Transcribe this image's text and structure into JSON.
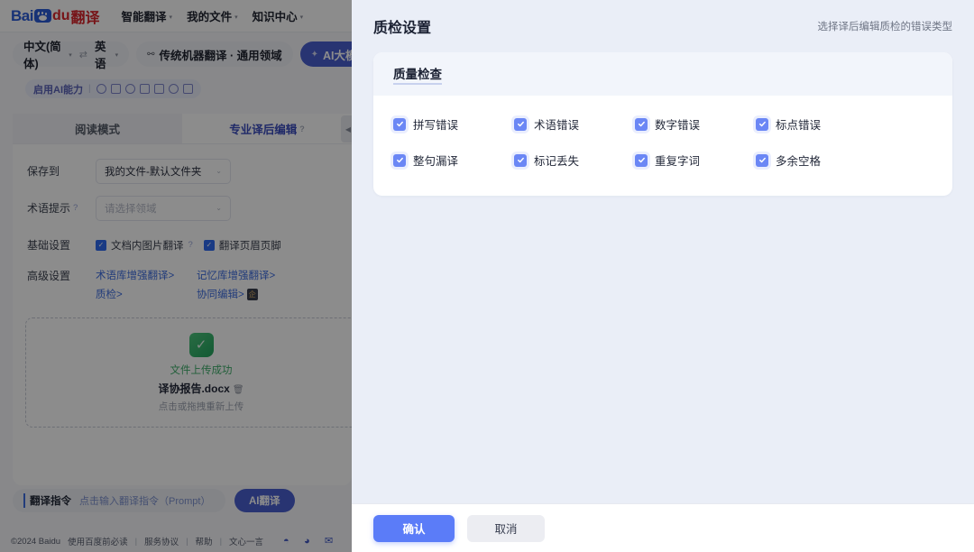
{
  "brand": {
    "logo_bai": "Bai",
    "logo_du": "du",
    "logo_suffix": "翻译",
    "paw_icon": "paw-icon"
  },
  "topnav": {
    "items": [
      {
        "label": "智能翻译",
        "caret": "▾"
      },
      {
        "label": "我的文件",
        "caret": "▾"
      },
      {
        "label": "知识中心",
        "caret": "▾"
      }
    ]
  },
  "langbar": {
    "source": "中文(简体)",
    "target": "英语",
    "swap_icon": "⇄",
    "caret": "▾",
    "modes": [
      {
        "label": "传统机器翻译 · 通用领域",
        "icon": "translate-icon",
        "active": false
      },
      {
        "label": "AI大模型",
        "icon": "sparkle-icon",
        "active": true
      }
    ]
  },
  "ai_row": {
    "label": "启用AI能力",
    "separator": "|",
    "icons": [
      "magic-wand-icon",
      "doc-scan-icon",
      "target-icon",
      "copy-icon",
      "edit-icon",
      "zoom-icon",
      "cube-icon"
    ]
  },
  "panel": {
    "tabs": [
      {
        "label": "阅读模式",
        "active": false
      },
      {
        "label": "专业译后编辑",
        "active": true,
        "help_icon": "?"
      }
    ],
    "fields": [
      {
        "label": "保存到",
        "value": "我的文件-默认文件夹",
        "placeholder": "",
        "is_placeholder": false,
        "chevron": "⌄"
      },
      {
        "label": "术语提示",
        "help_icon": "?",
        "value": "",
        "placeholder": "请选择领域",
        "is_placeholder": true,
        "chevron": "⌄"
      }
    ],
    "basic_settings": {
      "label": "基础设置",
      "options": [
        {
          "label": "文档内图片翻译",
          "checked": true,
          "help_icon": "?"
        },
        {
          "label": "翻译页眉页脚",
          "checked": true
        }
      ]
    },
    "advanced_settings": {
      "label": "高级设置",
      "links": [
        {
          "label": "术语库增强翻译",
          "arrow": ">"
        },
        {
          "label": "记忆库增强翻译",
          "arrow": ">"
        },
        {
          "label": "质检",
          "arrow": ">"
        },
        {
          "label": "协同编辑",
          "arrow": ">",
          "badge": "企"
        }
      ]
    },
    "collapse_handle_icon": "◀"
  },
  "upload": {
    "status_icon": "shield-check-icon",
    "status_text": "文件上传成功",
    "file_name": "译协报告.docx",
    "delete_icon": "🗑",
    "hint": "点击或拖拽重新上传"
  },
  "prompt_bar": {
    "tag": "翻译指令",
    "placeholder": "点击输入翻译指令（Prompt）",
    "action_button": "AI翻译"
  },
  "footer": {
    "copyright": "©2024 Baidu",
    "links": [
      "使用百度前必读",
      "服务协议",
      "帮助",
      "文心一言"
    ],
    "separator": "|",
    "social_icons": [
      "weibo-icon",
      "wechat-icon",
      "mail-icon"
    ]
  },
  "modal": {
    "title": "质检设置",
    "subtitle": "选择译后编辑质检的错误类型",
    "card": {
      "title": "质量检查",
      "options": [
        {
          "label": "拼写错误",
          "checked": true
        },
        {
          "label": "术语错误",
          "checked": true
        },
        {
          "label": "数字错误",
          "checked": true
        },
        {
          "label": "标点错误",
          "checked": true
        },
        {
          "label": "整句漏译",
          "checked": true
        },
        {
          "label": "标记丢失",
          "checked": true
        },
        {
          "label": "重复字词",
          "checked": true
        },
        {
          "label": "多余空格",
          "checked": true
        }
      ]
    },
    "footer": {
      "confirm": "确认",
      "cancel": "取消"
    }
  },
  "colors": {
    "primary": "#5b7cf8",
    "modal_bg": "#eaeef7",
    "card_head": "#f2f5fb",
    "brand_red": "#d9262c",
    "brand_blue": "#2b5bd7",
    "success_green": "#3fae6b"
  }
}
